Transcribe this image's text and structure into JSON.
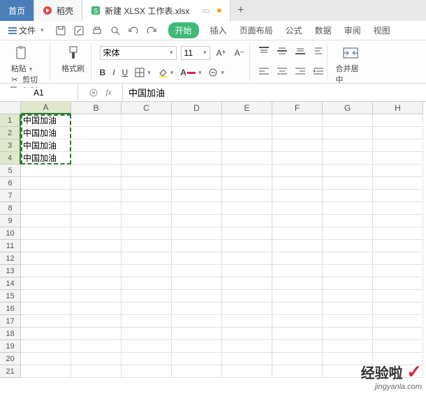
{
  "tabs": {
    "home": "首页",
    "daoke": "稻壳",
    "current": "新建 XLSX 工作表.xlsx"
  },
  "menu": {
    "file": "文件",
    "tabs": {
      "start": "开始",
      "insert": "插入",
      "layout": "页面布局",
      "formula": "公式",
      "data": "数据",
      "review": "审阅",
      "view": "视图"
    }
  },
  "ribbon": {
    "paste": "粘贴",
    "cut": "剪切",
    "copy": "复制",
    "format_painter": "格式刷",
    "font_name": "宋体",
    "font_size": "11",
    "bold": "B",
    "italic": "I",
    "underline": "U",
    "merge": "合并居中"
  },
  "namebox": "A1",
  "formula_value": "中国加油",
  "columns": [
    "A",
    "B",
    "C",
    "D",
    "E",
    "F",
    "G",
    "H"
  ],
  "row_count": 21,
  "selected_rows": 4,
  "cells": {
    "A1": "中国加油",
    "A2": "中国加油",
    "A3": "中国加油",
    "A4": "中国加油"
  },
  "watermark": {
    "line1": "经验啦",
    "line2": "jingyanla.com"
  }
}
